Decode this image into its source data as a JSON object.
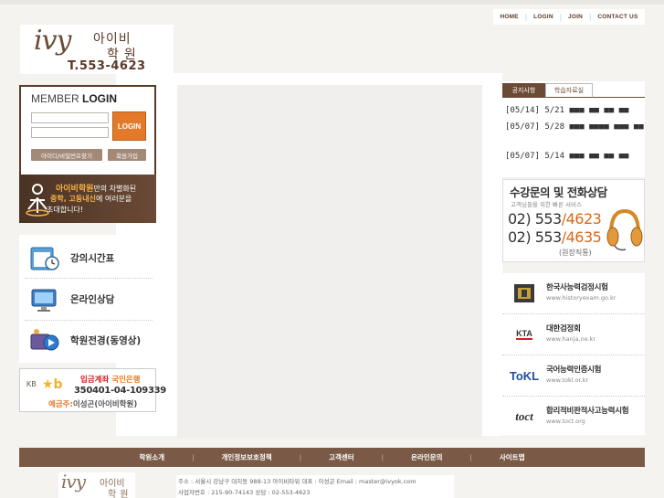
{
  "top_nav": {
    "home": "HOME",
    "login": "LOGIN",
    "join": "JOIN",
    "contact": "CONTACT US"
  },
  "logo": {
    "latin": "ivy",
    "korean1": "아이비",
    "korean2": "학원",
    "tel": "T.553-4623"
  },
  "member_login": {
    "title_light": "MEMBER ",
    "title_bold": "LOGIN",
    "login_button": "LOGIN",
    "find_button": "아이디/비밀번호찾기",
    "join_button": "회원가입"
  },
  "promo": {
    "line1_accent": "아이비학원",
    "line1_rest": "만의 차별화된",
    "line2_accent": "중학, 고등내신",
    "line2_rest": "에 여러분을",
    "line3": "초대합니다!"
  },
  "quick_menu": [
    {
      "label": "강의시간표",
      "icon": "timetable-icon"
    },
    {
      "label": "온라인상담",
      "icon": "monitor-icon"
    },
    {
      "label": "학원전경(동영상)",
      "icon": "video-icon"
    }
  ],
  "bank": {
    "bank_logo": "KB",
    "bank_star": "★b",
    "title_red": "입금계좌",
    "title_bank": "국민은행",
    "account": "350401-04-109339",
    "holder_label": "예금주:",
    "holder": "이성곤(아이비학원)"
  },
  "notice": {
    "tab_active": "공지사항",
    "tab_inactive": "학습자료실",
    "items": [
      {
        "date": "[05/14] 5/21 ■■■ ■■ ■■ ■■"
      },
      {
        "date": "[05/07] 5/28 ■■■ ■■■■ ■■■ ■■"
      },
      {
        "date": "[05/07] 5/14 ■■■ ■■ ■■ ■■"
      }
    ]
  },
  "consult": {
    "title": "수강문의 및 전화상담",
    "subtitle": "고객님들을 위한 빠른 서비스",
    "phone1_main": "02) 553",
    "phone1_ext": "/4623",
    "phone2_main": "02) 553",
    "phone2_ext": "/4635",
    "note": "(원장직통)"
  },
  "links": [
    {
      "name": "한국사능력검정시험",
      "url": "www.historyexam.go.kr",
      "logo": "koreanhistory-logo"
    },
    {
      "name": "대한검정회",
      "url": "www.hanja.ne.kr",
      "logo": "kta-logo"
    },
    {
      "name": "국어능력인증시험",
      "url": "www.tokl.or.kr",
      "logo": "tokl-logo"
    },
    {
      "name": "합리적비판적사고능력시험",
      "url": "www.toct.org",
      "logo": "toct-logo"
    }
  ],
  "link_logos": {
    "kta": "KTA",
    "tokl": "ToKL",
    "toct": "toct"
  },
  "footer": {
    "links": [
      "학원소개",
      "개인정보보호정책",
      "고객센터",
      "온라인문의",
      "사이트맵"
    ],
    "logo_latin": "ivy",
    "logo_korean1": "아이비",
    "logo_korean2": "학원",
    "info1": "주소 : 서울시 강남구 대치동 988-13 아이비타워    대표 : 이성곤    Email : master@ivyok.com",
    "info2": "사업자번호 : 215-90-74143     상담 : 02-553-4623"
  },
  "colors": {
    "brown": "#6b4a36",
    "footer": "#7a5a46",
    "orange": "#e37a2a",
    "bg": "#f5f3f0"
  }
}
